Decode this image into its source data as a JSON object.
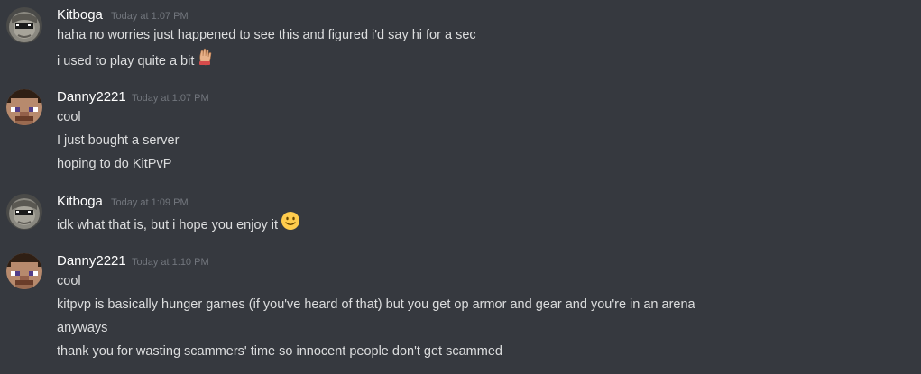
{
  "messages": [
    {
      "author": "Kitboga",
      "timestamp": "Today at 1:07 PM",
      "avatar": "kitboga-avatar",
      "lines": [
        "haha no worries just happened to see this and figured i'd say hi for a sec",
        "i used to play quite a bit"
      ],
      "emoji": "raised-hand-emoji"
    },
    {
      "author": "Danny2221",
      "timestamp": "Today at 1:07 PM",
      "avatar": "minecraft-steve-avatar",
      "lines": [
        "cool",
        "I just bought a server",
        "hoping to do KitPvP"
      ]
    },
    {
      "author": "Kitboga",
      "timestamp": "Today at 1:09 PM",
      "avatar": "kitboga-avatar",
      "lines": [
        "idk what that is, but i hope you enjoy it"
      ],
      "emoji": "slightly-smiling-face-emoji"
    },
    {
      "author": "Danny2221",
      "timestamp": "Today at 1:10 PM",
      "avatar": "minecraft-steve-avatar",
      "lines": [
        "cool",
        "kitpvp is basically hunger games (if you've heard of that) but you get op armor and gear and you're in an arena",
        "anyways",
        "thank you for wasting scammers' time so innocent people don't get scammed"
      ]
    }
  ],
  "colors": {
    "background": "#36393f",
    "username": "#ffffff",
    "text": "#dcddde",
    "timestamp": "#72767d"
  }
}
